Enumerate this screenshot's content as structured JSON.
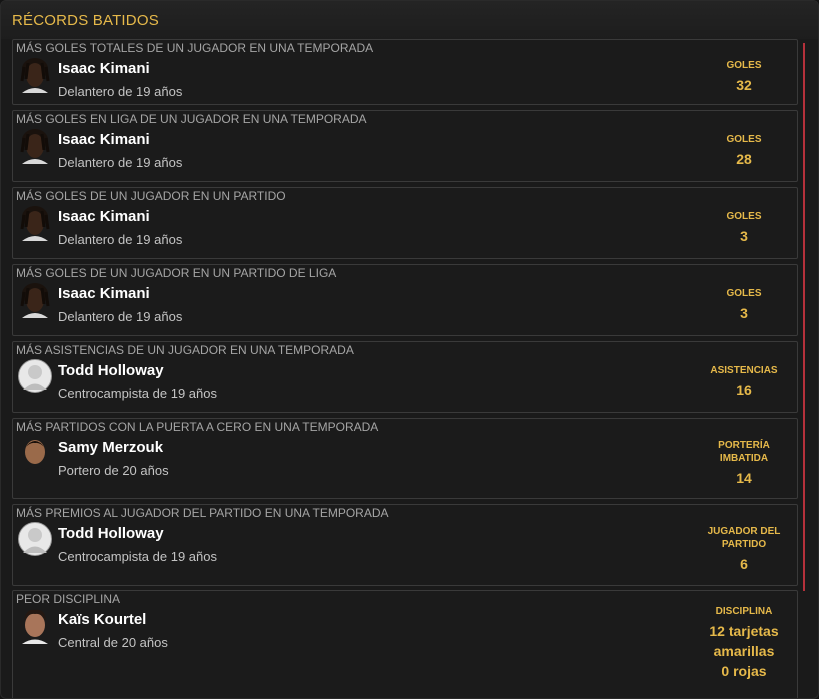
{
  "panel": {
    "title": "RÉCORDS BATIDOS"
  },
  "records": [
    {
      "title": "MÁS GOLES TOTALES DE UN JUGADOR EN UNA TEMPORADA",
      "player": {
        "name": "Isaac Kimani",
        "desc": "Delantero de 19 años",
        "avatar_icon": "player-photo-dark-skin-dreadlocks"
      },
      "stat": {
        "label": [
          "GOLES"
        ],
        "value": [
          "32"
        ]
      }
    },
    {
      "title": "MÁS GOLES EN LIGA DE UN JUGADOR EN UNA TEMPORADA",
      "player": {
        "name": "Isaac Kimani",
        "desc": "Delantero de 19 años",
        "avatar_icon": "player-photo-dark-skin-dreadlocks"
      },
      "stat": {
        "label": [
          "GOLES"
        ],
        "value": [
          "28"
        ]
      }
    },
    {
      "title": "MÁS GOLES DE UN JUGADOR EN UN PARTIDO",
      "player": {
        "name": "Isaac Kimani",
        "desc": "Delantero de 19 años",
        "avatar_icon": "player-photo-dark-skin-dreadlocks"
      },
      "stat": {
        "label": [
          "GOLES"
        ],
        "value": [
          "3"
        ]
      }
    },
    {
      "title": "MÁS GOLES DE UN JUGADOR EN UN PARTIDO DE LIGA",
      "player": {
        "name": "Isaac Kimani",
        "desc": "Delantero de 19 años",
        "avatar_icon": "player-photo-dark-skin-dreadlocks"
      },
      "stat": {
        "label": [
          "GOLES"
        ],
        "value": [
          "3"
        ]
      }
    },
    {
      "title": "MÁS ASISTENCIAS DE UN JUGADOR EN UNA TEMPORADA",
      "player": {
        "name": "Todd Holloway",
        "desc": "Centrocampista de 19 años",
        "avatar_icon": "player-silhouette-placeholder"
      },
      "stat": {
        "label": [
          "ASISTENCIAS"
        ],
        "value": [
          "16"
        ]
      }
    },
    {
      "title": "MÁS PARTIDOS CON LA PUERTA A CERO EN UNA TEMPORADA",
      "player": {
        "name": "Samy Merzouk",
        "desc": "Portero de 20 años",
        "avatar_icon": "player-photo-dark-hair"
      },
      "stat": {
        "label": [
          "PORTERÍA",
          "IMBATIDA"
        ],
        "value": [
          "14"
        ]
      }
    },
    {
      "title": "MÁS PREMIOS AL JUGADOR DEL PARTIDO EN UNA TEMPORADA",
      "player": {
        "name": "Todd Holloway",
        "desc": "Centrocampista de 19 años",
        "avatar_icon": "player-silhouette-placeholder"
      },
      "stat": {
        "label": [
          "JUGADOR DEL",
          "PARTIDO"
        ],
        "value": [
          "6"
        ]
      }
    },
    {
      "title": "PEOR DISCIPLINA",
      "player": {
        "name": "Kaïs Kourtel",
        "desc": "Central de 20 años",
        "avatar_icon": "player-photo-curly-hair"
      },
      "stat": {
        "label": [
          "DISCIPLINA"
        ],
        "value": [
          "12 tarjetas",
          "amarillas",
          "0 rojas"
        ]
      }
    }
  ],
  "colors": {
    "accent": "#e6b94a",
    "scrollbar": "#b5313b",
    "background": "#1a1a1a"
  }
}
